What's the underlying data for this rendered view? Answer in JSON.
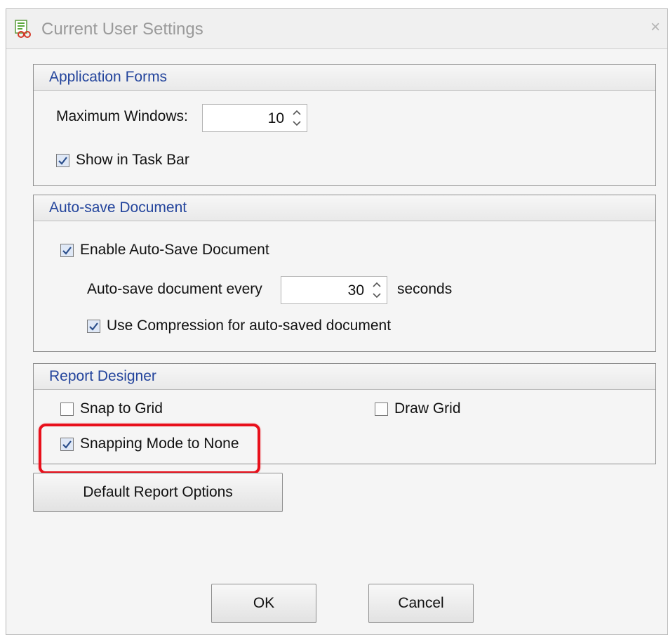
{
  "window": {
    "title": "Current User Settings",
    "close_symbol": "×",
    "icon": "app-icon"
  },
  "application_forms": {
    "title": "Application Forms",
    "max_windows_label": "Maximum Windows:",
    "max_windows_value": "10",
    "show_in_taskbar_label": "Show in Task Bar",
    "show_in_taskbar_checked": true
  },
  "auto_save": {
    "title": "Auto-save Document",
    "enable_label": "Enable Auto-Save Document",
    "enable_checked": true,
    "every_label": "Auto-save document every",
    "every_value": "30",
    "seconds_label": "seconds",
    "compression_label": "Use Compression for auto-saved document",
    "compression_checked": true
  },
  "report_designer": {
    "title": "Report Designer",
    "snap_to_grid_label": "Snap to Grid",
    "snap_to_grid_checked": false,
    "draw_grid_label": "Draw Grid",
    "draw_grid_checked": false,
    "snapping_mode_label": "Snapping Mode to None",
    "snapping_mode_checked": true,
    "highlight_color": "#e8101b"
  },
  "buttons": {
    "default_report_options": "Default Report Options",
    "ok": "OK",
    "cancel": "Cancel"
  },
  "colors": {
    "group_title": "#23449c",
    "check_fill": "#dfe8f6",
    "check_mark": "#2b4f8c"
  }
}
